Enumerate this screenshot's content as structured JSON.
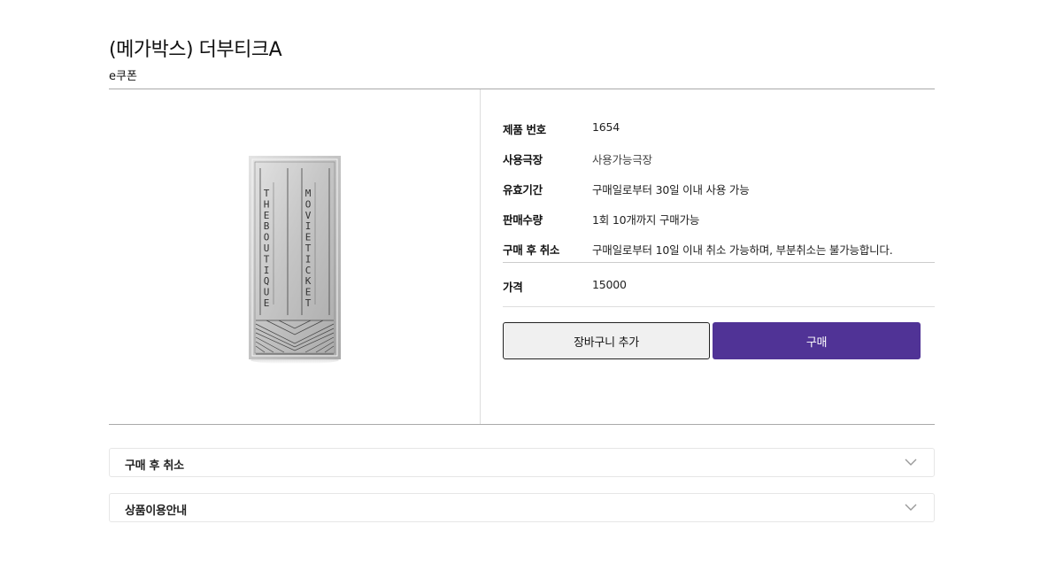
{
  "product": {
    "title": "(메가박스) 더부티크A",
    "type": "e쿠폰"
  },
  "details": [
    {
      "label": "제품 번호",
      "value": "1654"
    },
    {
      "label": "사용극장",
      "value": "사용가능극장"
    },
    {
      "label": "유효기간",
      "value": "구매일로부터 30일 이내 사용 가능"
    },
    {
      "label": "판매수량",
      "value": "1회 10개까지 구매가능"
    },
    {
      "label": "구매 후 취소",
      "value": "구매일로부터 10일 이내 취소 가능하며, 부분취소는 불가능합니다."
    }
  ],
  "price": {
    "label": "가격",
    "value": "15000"
  },
  "buttons": {
    "cart": "장바구니 추가",
    "buy": "구매"
  },
  "accordions": [
    {
      "label": "구매 후 취소"
    },
    {
      "label": "상품이용안내"
    }
  ],
  "ticket_image": {
    "left_text": "THE BOUTIQUE",
    "right_text": "MOVIE TICKET",
    "logo_text": "M"
  },
  "colors": {
    "buy_button": "#503396",
    "cart_button": "#f0f0f0"
  },
  "icons": {
    "accordion_toggle": "chevron-down-icon"
  }
}
